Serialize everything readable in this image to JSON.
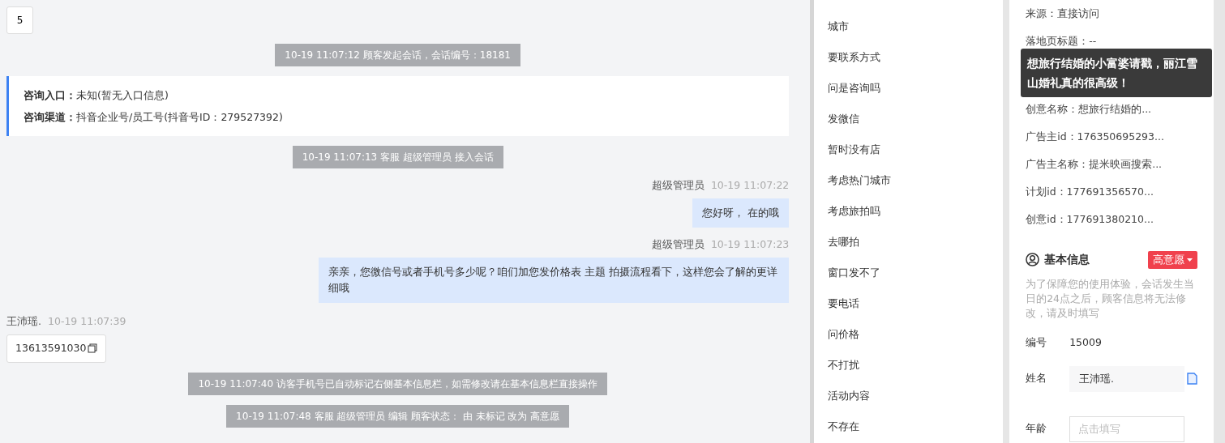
{
  "chat": {
    "page_button": "5",
    "messages": [
      {
        "kind": "system",
        "text": "10-19 11:07:12 顾客发起会话，会话编号：18181"
      },
      {
        "kind": "entry",
        "lines": [
          {
            "label": "咨询入口：",
            "value": "未知(暂无入口信息)"
          },
          {
            "label": "咨询渠道：",
            "value": "抖音企业号/员工号(抖音号ID：279527392)"
          }
        ]
      },
      {
        "kind": "system",
        "text": "10-19 11:07:13 客服 超级管理员 接入会话"
      },
      {
        "kind": "agent",
        "sender": "超级管理员",
        "time": "10-19 11:07:22",
        "text": "您好呀， 在的哦"
      },
      {
        "kind": "agent",
        "sender": "超级管理员",
        "time": "10-19 11:07:23",
        "text": "亲亲，您微信号或者手机号多少呢？咱们加您发价格表 主题 拍摄流程看下，这样您会了解的更详细哦"
      },
      {
        "kind": "customer",
        "sender": "王沛瑶.",
        "time": "10-19 11:07:39",
        "text": "13613591030"
      },
      {
        "kind": "system",
        "text": "10-19 11:07:40 访客手机号已自动标记右侧基本信息栏，如需修改请在基本信息栏直接操作"
      },
      {
        "kind": "system",
        "text": "10-19 11:07:48 客服 超级管理员 编辑 顾客状态： 由 未标记 改为 高意愿"
      }
    ]
  },
  "quick_replies": [
    "城市",
    "要联系方式",
    "问是咨询吗",
    "发微信",
    "暂时没有店",
    "考虑热门城市",
    "考虑旅拍吗",
    "去哪拍",
    "窗口发不了",
    "要电话",
    "问价格",
    "不打扰",
    "活动内容",
    "不存在"
  ],
  "info": {
    "source_rows": [
      "来源：直接访问",
      "落地页标题：--"
    ],
    "tooltip": "想旅行结婚的小富婆请戳，丽江雪山婚礼真的很高级！",
    "ad_rows": [
      "创意名称：想旅行结婚的...",
      "广告主id：176350695293...",
      "广告主名称：提米映画搜索...",
      "计划id：177691356570...",
      "创意id：177691380210..."
    ],
    "basic": {
      "title": "基本信息",
      "status": {
        "text": "高意愿",
        "color": "#f0414d"
      },
      "notice": "为了保障您的使用体验，会话发生当日的24点之后，顾客信息将无法修改，请及时填写",
      "fields": [
        {
          "kind": "text",
          "label": "编号",
          "value": "15009"
        },
        {
          "kind": "filled",
          "label": "姓名",
          "value": "王沛瑶."
        },
        {
          "kind": "input",
          "label": "年龄",
          "placeholder": "点击填写"
        }
      ]
    }
  }
}
